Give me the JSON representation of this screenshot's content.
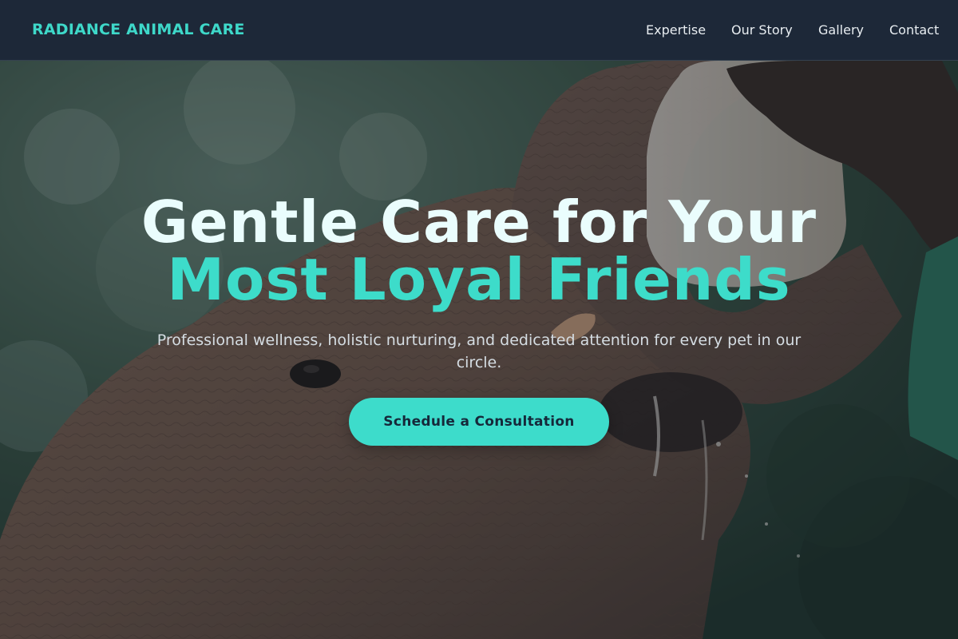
{
  "header": {
    "logo": "RADIANCE ANIMAL CARE",
    "nav": [
      {
        "label": "Expertise"
      },
      {
        "label": "Our Story"
      },
      {
        "label": "Gallery"
      },
      {
        "label": "Contact"
      }
    ]
  },
  "hero": {
    "headline_line1": "Gentle Care for Your",
    "headline_line2": "Most Loyal Friends",
    "subtitle": "Professional wellness, holistic nurturing, and dedicated attention for every pet in our circle.",
    "cta_label": "Schedule a Consultation"
  },
  "colors": {
    "accent": "#3ddccb",
    "header_bg": "#1d2838",
    "headline_light": "#eafdfd",
    "cta_text": "#16283a"
  }
}
